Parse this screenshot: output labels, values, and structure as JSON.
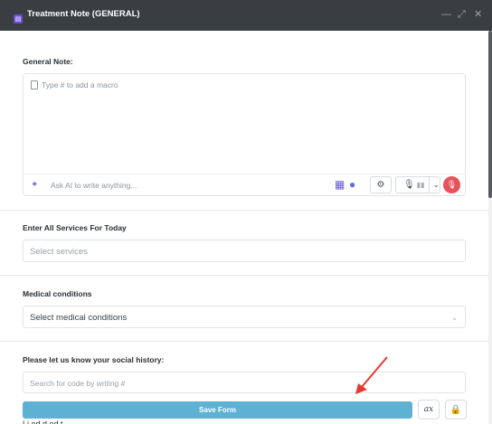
{
  "window": {
    "title": "Treatment Note (GENERAL)",
    "app_icon": "form-icon",
    "controls": {
      "minimize": "—",
      "maximize": "⤢",
      "close": "✕"
    }
  },
  "general_note": {
    "label": "General Note:",
    "placeholder": "Type # to add a macro",
    "ai_placeholder": "Ask AI to write anything..."
  },
  "services": {
    "label": "Enter All Services For Today",
    "placeholder": "Select services"
  },
  "medical": {
    "label": "Medical conditions",
    "placeholder": "Select medical conditions"
  },
  "social_history": {
    "label": "Please let us know your social history:",
    "placeholder": "Search for code by writing #"
  },
  "footer": {
    "save_label": "Save Form",
    "clear_format_label": "ax",
    "lock_icon": "lock-icon",
    "partial_text": "Li         ed   d   ed   t     "
  },
  "colors": {
    "titlebar": "#3a3d41",
    "save_button": "#5fb1d4",
    "record_button": "#e8505b",
    "annotation_arrow": "#e8382f"
  }
}
